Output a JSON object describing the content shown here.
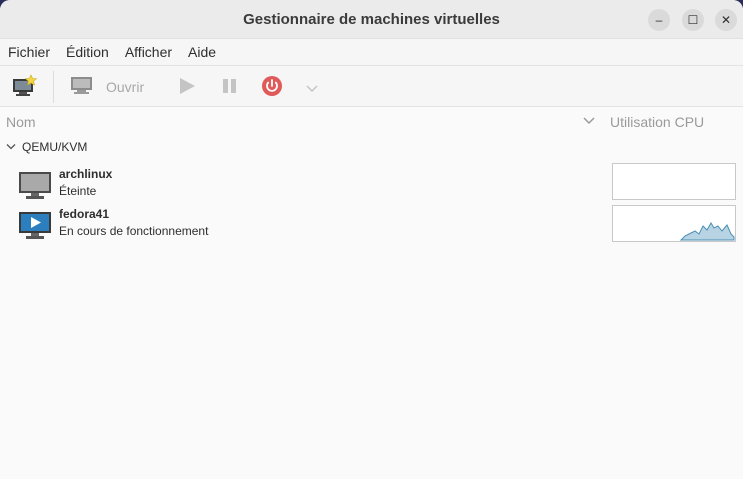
{
  "window": {
    "title": "Gestionnaire de machines virtuelles",
    "controls": [
      "minimize",
      "maximize",
      "close"
    ]
  },
  "menubar": {
    "items": [
      "Fichier",
      "Édition",
      "Afficher",
      "Aide"
    ]
  },
  "toolbar": {
    "new_vm_icon": "new-vm-icon",
    "open_label": "Ouvrir",
    "run_icon": "play-icon",
    "pause_icon": "pause-icon",
    "shutdown_icon": "power-icon",
    "shutdown_color": "#e05a5a",
    "menu_icon": "chevron-down-icon"
  },
  "list": {
    "col_name": "Nom",
    "col_cpu": "Utilisation CPU",
    "group": "QEMU/KVM",
    "vms": [
      {
        "name": "archlinux",
        "status": "Éteinte",
        "running": false
      },
      {
        "name": "fedora41",
        "status": "En cours de fonctionnement",
        "running": true,
        "cpu_color": "#4a8fb3"
      }
    ]
  }
}
